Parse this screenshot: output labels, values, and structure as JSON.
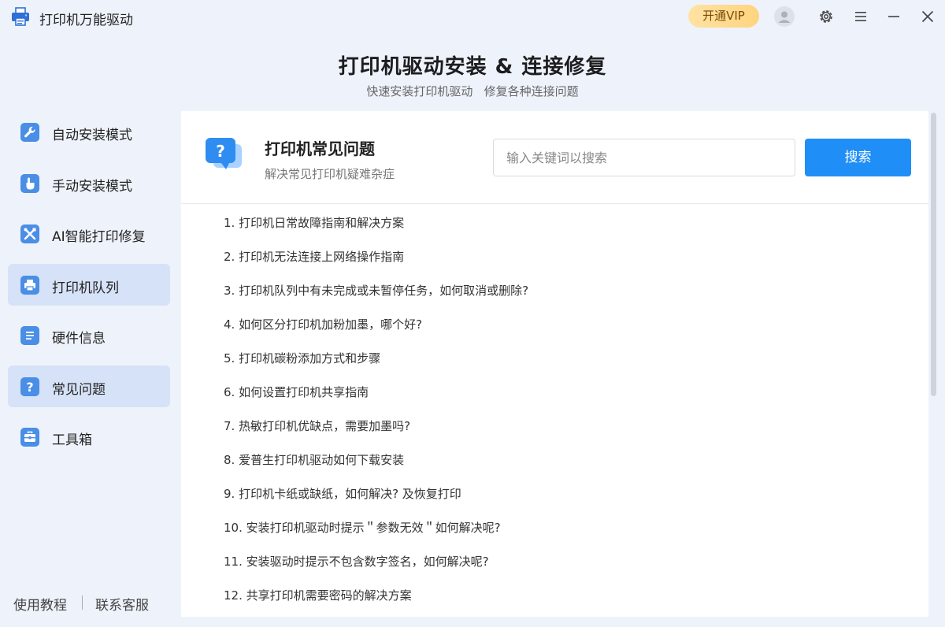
{
  "window": {
    "app_title": "打印机万能驱动",
    "vip_label": "开通VIP"
  },
  "header": {
    "title": "打印机驱动安装 & 连接修复",
    "subtitle": "快速安装打印机驱动   修复各种连接问题"
  },
  "sidebar": {
    "items": [
      {
        "label": "自动安装模式",
        "icon": "wrench-icon",
        "active": false
      },
      {
        "label": "手动安装模式",
        "icon": "hand-icon",
        "active": false
      },
      {
        "label": "AI智能打印修复",
        "icon": "tools-icon",
        "active": false
      },
      {
        "label": "打印机队列",
        "icon": "printer-icon",
        "active": true
      },
      {
        "label": "硬件信息",
        "icon": "list-icon",
        "active": false
      },
      {
        "label": "常见问题",
        "icon": "question-icon",
        "active": true
      },
      {
        "label": "工具箱",
        "icon": "toolbox-icon",
        "active": false
      }
    ],
    "footer": {
      "tutorial": "使用教程",
      "support": "联系客服"
    }
  },
  "panel": {
    "title": "打印机常见问题",
    "subtitle": "解决常见打印机疑难杂症",
    "search_placeholder": "输入关键词以搜索",
    "search_value": "",
    "search_button": "搜索",
    "faq": [
      "1. 打印机日常故障指南和解决方案",
      "2. 打印机无法连接上网络操作指南",
      "3. 打印机队列中有未完成或未暂停任务，如何取消或删除?",
      "4. 如何区分打印机加粉加墨，哪个好?",
      "5. 打印机碳粉添加方式和步骤",
      "6. 如何设置打印机共享指南",
      "7. 热敏打印机优缺点，需要加墨吗?",
      "8. 爱普生打印机驱动如何下载安装",
      "9. 打印机卡纸或缺纸，如何解决? 及恢复打印",
      "10. 安装打印机驱动时提示＂参数无效＂如何解决呢?",
      "11. 安装驱动时提示不包含数字签名，如何解决呢?",
      "12. 共享打印机需要密码的解决方案"
    ]
  },
  "colors": {
    "accent": "#1f8ff7",
    "sidebar_active": "#d6e2f7",
    "background": "#eef3fb",
    "icon_blue": "#4a8ee6"
  }
}
